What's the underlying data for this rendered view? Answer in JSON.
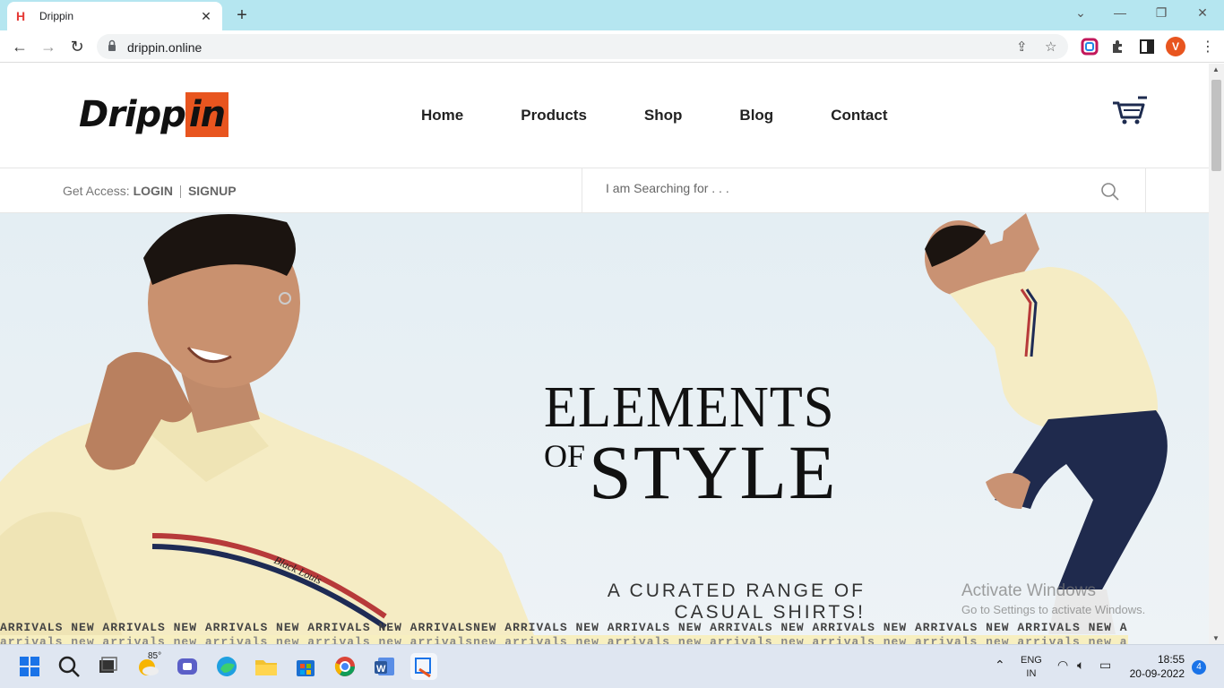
{
  "browser": {
    "tab_title": "Drippin",
    "tab_favicon": "H",
    "url": "drippin.online",
    "profile_initial": "V"
  },
  "site": {
    "logo_part1": "Dripp",
    "logo_part2": "in",
    "nav": [
      "Home",
      "Products",
      "Shop",
      "Blog",
      "Contact"
    ],
    "access_label": "Get Access:",
    "login_label": "LOGIN",
    "signup_label": "SIGNUP",
    "search_placeholder": "I am Searching for . . .",
    "accent_color": "#e8551f"
  },
  "hero": {
    "headline_line1": "ELEMENTS",
    "headline_of": "OF",
    "headline_style": "STYLE",
    "tagline_line1": "A CURATED RANGE OF",
    "tagline_line2": "CASUAL SHIRTS!",
    "ticker_text": "ARRIVALS NEW ARRIVALS NEW ARRIVALS NEW ARRIVALS NEW ARRIVALSNEW ARRIVALS NEW ARRIVALS NEW ARRIVALS NEW ARRIVALS NEW ARRIVALS NEW ARRIVALS NEW A",
    "ticker_text2": "arrivals new arrivals new arrivals new arrivals new arrivalsnew arrivals new arrivals new arrivals new arrivals new arrivals new arrivals new a",
    "shirt_text": "Black Louis"
  },
  "watermark": {
    "line1": "Activate Windows",
    "line2": "Go to Settings to activate Windows."
  },
  "taskbar": {
    "weather_temp": "85°",
    "lang1": "ENG",
    "lang2": "IN",
    "time": "18:55",
    "date": "20-09-2022",
    "notifications": "4"
  }
}
